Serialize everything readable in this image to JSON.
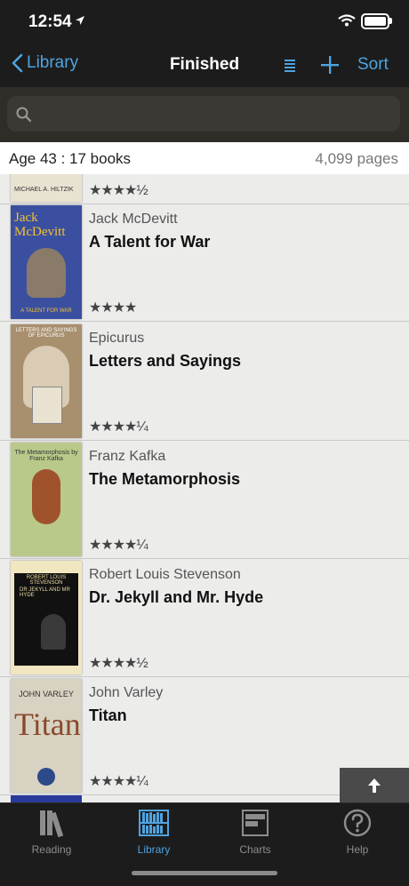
{
  "status": {
    "time": "12:54"
  },
  "nav": {
    "back_label": "Library",
    "title": "Finished",
    "sort_label": "Sort"
  },
  "search": {
    "placeholder": ""
  },
  "summary": {
    "left": "Age 43 : 17 books",
    "right": "4,099 pages"
  },
  "partial_row": {
    "rating": "★★★★½",
    "cover_text": "MICHAEL A. HILTZIK"
  },
  "books": [
    {
      "author": "Jack McDevitt",
      "title": "A Talent for War",
      "rating": "★★★★",
      "cover_bg": "#3b4fa0",
      "cover_fg": "#f2c230",
      "cover_text": "Jack McDevitt",
      "cover_sub": "A TALENT FOR WAR"
    },
    {
      "author": "Epicurus",
      "title": "Letters and Sayings",
      "rating": "★★★★¼",
      "cover_bg": "#a88f6e",
      "cover_fg": "#ffffff",
      "cover_text": "LETTERS AND SAYINGS OF EPICURUS",
      "cover_sub": ""
    },
    {
      "author": "Franz Kafka",
      "title": "The Metamorphosis",
      "rating": "★★★★¼",
      "cover_bg": "#b9c98a",
      "cover_fg": "#333333",
      "cover_text": "The Metamorphosis by Franz Kafka",
      "cover_sub": ""
    },
    {
      "author": "Robert Louis Stevenson",
      "title": "Dr. Jekyll and Mr. Hyde",
      "rating": "★★★★½",
      "cover_bg": "#111111",
      "cover_fg": "#e8d9a0",
      "cover_text": "ROBERT LOUIS STEVENSON",
      "cover_sub": "DR JEKYLL AND MR HYDE"
    },
    {
      "author": "John Varley",
      "title": "Titan",
      "rating": "★★★★¼",
      "cover_bg": "#d8d2c2",
      "cover_fg": "#8a4a2a",
      "cover_text": "JOHN VARLEY",
      "cover_sub": "Titan"
    }
  ],
  "tabs": [
    {
      "label": "Reading",
      "icon": "books-icon"
    },
    {
      "label": "Library",
      "icon": "library-shelf-icon"
    },
    {
      "label": "Charts",
      "icon": "charts-icon"
    },
    {
      "label": "Help",
      "icon": "help-icon"
    }
  ],
  "colors": {
    "accent": "#4fa3e0",
    "bar": "#1c1c1c",
    "list_bg": "#ececeb"
  }
}
